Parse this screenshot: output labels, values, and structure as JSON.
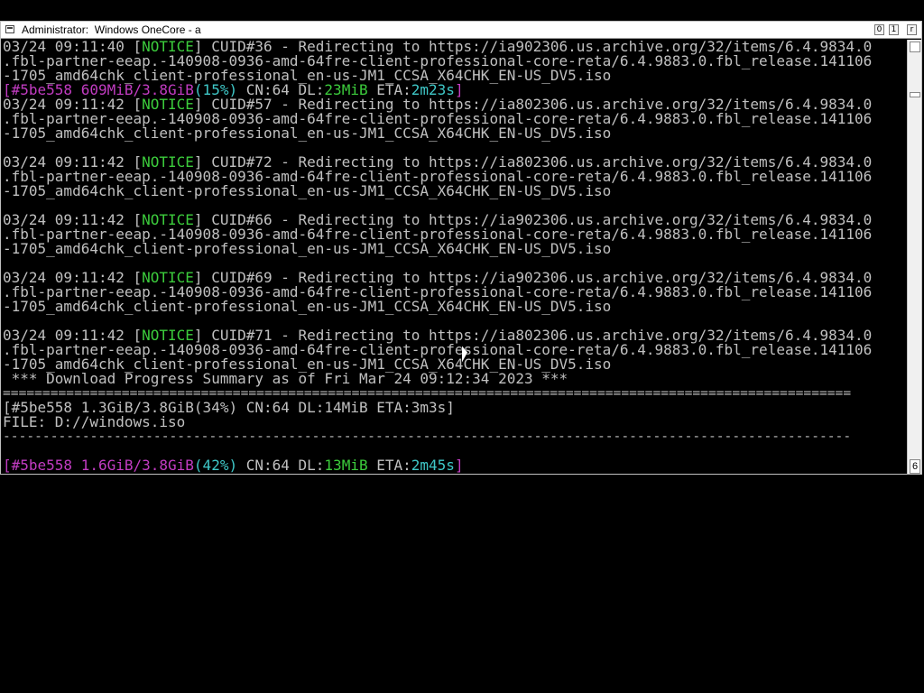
{
  "window": {
    "title": "Administrator:  Windows OneCore - a",
    "controls": {
      "minimize": "0",
      "maximize": "1",
      "close": "r"
    },
    "scroll_down_glyph": "6"
  },
  "console": {
    "lines": [
      {
        "parts": [
          {
            "text": "03/24 09:11:40 ["
          },
          {
            "text": "NOTICE",
            "color": "green"
          },
          {
            "text": "] CUID#36 - Redirecting to https://ia902306.us.archive.org/32/items/6.4.9834.0"
          }
        ]
      },
      {
        "parts": [
          {
            "text": ".fbl-partner-eeap.-140908-0936-amd-64fre-client-professional-core-reta/6.4.9883.0.fbl_release.141106"
          }
        ]
      },
      {
        "parts": [
          {
            "text": "-1705_amd64chk_client-professional_en-us-JM1_CCSA_X64CHK_EN-US_DV5.iso"
          }
        ]
      },
      {
        "parts": [
          {
            "text": "[#5be558 609MiB/3.8GiB",
            "color": "mag"
          },
          {
            "text": "(15%)",
            "color": "cyan"
          },
          {
            "text": " CN:64 DL:"
          },
          {
            "text": "23MiB",
            "color": "green"
          },
          {
            "text": " ETA:"
          },
          {
            "text": "2m23s",
            "color": "cyan"
          },
          {
            "text": "]",
            "color": "mag"
          }
        ]
      },
      {
        "parts": [
          {
            "text": "03/24 09:11:42 ["
          },
          {
            "text": "NOTICE",
            "color": "green"
          },
          {
            "text": "] CUID#57 - Redirecting to https://ia802306.us.archive.org/32/items/6.4.9834.0"
          }
        ]
      },
      {
        "parts": [
          {
            "text": ".fbl-partner-eeap.-140908-0936-amd-64fre-client-professional-core-reta/6.4.9883.0.fbl_release.141106"
          }
        ]
      },
      {
        "parts": [
          {
            "text": "-1705_amd64chk_client-professional_en-us-JM1_CCSA_X64CHK_EN-US_DV5.iso"
          }
        ]
      },
      {
        "parts": [
          {
            "text": ""
          }
        ]
      },
      {
        "parts": [
          {
            "text": "03/24 09:11:42 ["
          },
          {
            "text": "NOTICE",
            "color": "green"
          },
          {
            "text": "] CUID#72 - Redirecting to https://ia802306.us.archive.org/32/items/6.4.9834.0"
          }
        ]
      },
      {
        "parts": [
          {
            "text": ".fbl-partner-eeap.-140908-0936-amd-64fre-client-professional-core-reta/6.4.9883.0.fbl_release.141106"
          }
        ]
      },
      {
        "parts": [
          {
            "text": "-1705_amd64chk_client-professional_en-us-JM1_CCSA_X64CHK_EN-US_DV5.iso"
          }
        ]
      },
      {
        "parts": [
          {
            "text": ""
          }
        ]
      },
      {
        "parts": [
          {
            "text": "03/24 09:11:42 ["
          },
          {
            "text": "NOTICE",
            "color": "green"
          },
          {
            "text": "] CUID#66 - Redirecting to https://ia902306.us.archive.org/32/items/6.4.9834.0"
          }
        ]
      },
      {
        "parts": [
          {
            "text": ".fbl-partner-eeap.-140908-0936-amd-64fre-client-professional-core-reta/6.4.9883.0.fbl_release.141106"
          }
        ]
      },
      {
        "parts": [
          {
            "text": "-1705_amd64chk_client-professional_en-us-JM1_CCSA_X64CHK_EN-US_DV5.iso"
          }
        ]
      },
      {
        "parts": [
          {
            "text": ""
          }
        ]
      },
      {
        "parts": [
          {
            "text": "03/24 09:11:42 ["
          },
          {
            "text": "NOTICE",
            "color": "green"
          },
          {
            "text": "] CUID#69 - Redirecting to https://ia902306.us.archive.org/32/items/6.4.9834.0"
          }
        ]
      },
      {
        "parts": [
          {
            "text": ".fbl-partner-eeap.-140908-0936-amd-64fre-client-professional-core-reta/6.4.9883.0.fbl_release.141106"
          }
        ]
      },
      {
        "parts": [
          {
            "text": "-1705_amd64chk_client-professional_en-us-JM1_CCSA_X64CHK_EN-US_DV5.iso"
          }
        ]
      },
      {
        "parts": [
          {
            "text": ""
          }
        ]
      },
      {
        "parts": [
          {
            "text": "03/24 09:11:42 ["
          },
          {
            "text": "NOTICE",
            "color": "green"
          },
          {
            "text": "] CUID#71 - Redirecting to https://ia802306.us.archive.org/32/items/6.4.9834.0"
          }
        ]
      },
      {
        "parts": [
          {
            "text": ".fbl-partner-eeap.-140908-0936-amd-64fre-client-professional-core-reta/6.4.9883.0.fbl_release.141106"
          }
        ]
      },
      {
        "parts": [
          {
            "text": "-1705_amd64chk_client-professional_en-us-JM1_CCSA_X64CHK_EN-US_DV5.iso"
          }
        ]
      },
      {
        "parts": [
          {
            "text": " *** Download Progress Summary as of Fri Mar 24 09:12:34 2023 ***"
          }
        ]
      },
      {
        "sep": true,
        "parts": [
          {
            "text": "==========================================================================================================="
          }
        ]
      },
      {
        "parts": [
          {
            "text": "[#5be558 1.3GiB/3.8GiB(34%) CN:64 DL:14MiB ETA:3m3s]"
          }
        ]
      },
      {
        "parts": [
          {
            "text": "FILE: D://windows.iso"
          }
        ]
      },
      {
        "sep": true,
        "parts": [
          {
            "text": "-----------------------------------------------------------------------------------------------------------"
          }
        ]
      },
      {
        "parts": [
          {
            "text": ""
          }
        ]
      },
      {
        "parts": [
          {
            "text": "[#5be558 1.6GiB/3.8GiB",
            "color": "mag"
          },
          {
            "text": "(42%)",
            "color": "cyan"
          },
          {
            "text": " CN:64 DL:"
          },
          {
            "text": "13MiB",
            "color": "green"
          },
          {
            "text": " ETA:"
          },
          {
            "text": "2m45s",
            "color": "cyan"
          },
          {
            "text": "]",
            "color": "mag"
          }
        ]
      }
    ]
  },
  "colors": {
    "green": "#3ccc3c",
    "cyan": "#3fc8c8",
    "mag": "#c23cc2",
    "text": "#c0c0c0",
    "background": "#000000"
  },
  "icons": {
    "system_menu": "console-window-icon",
    "cursor": "mouse-pointer-icon"
  }
}
